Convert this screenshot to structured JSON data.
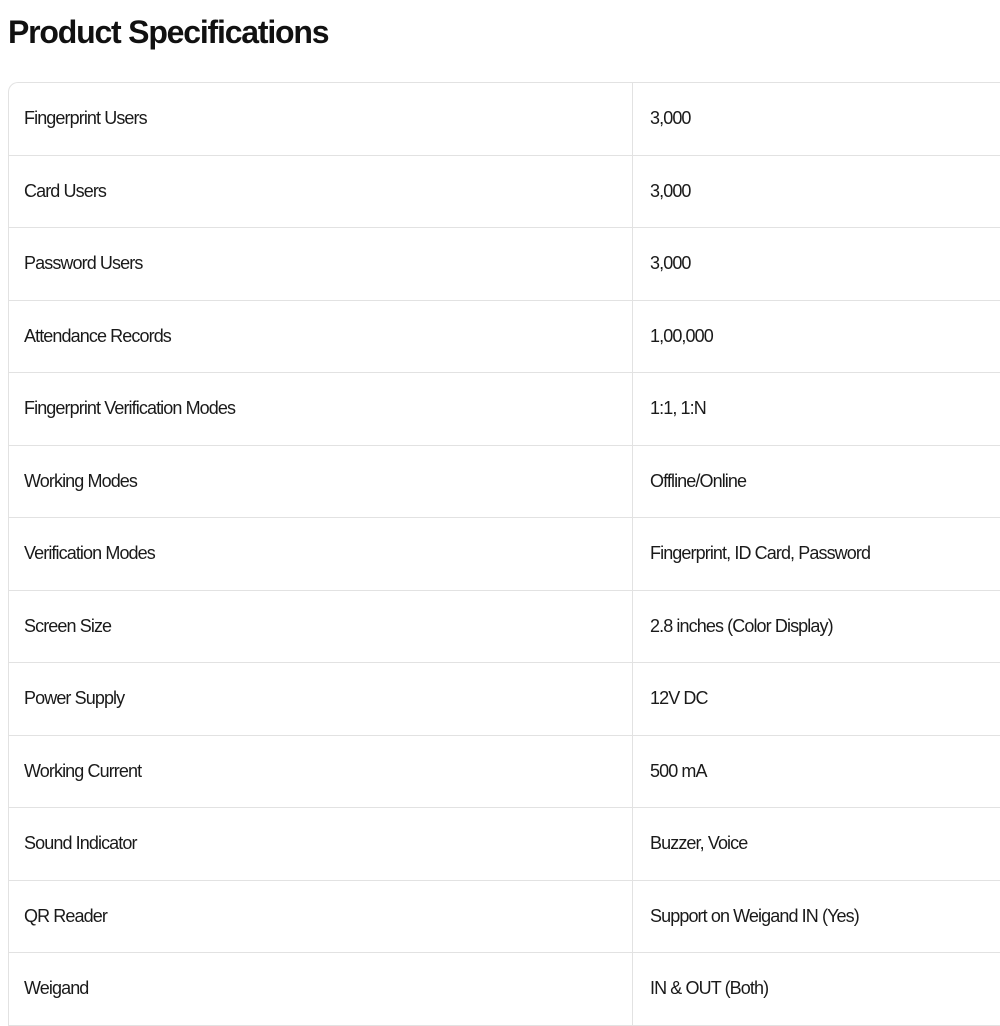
{
  "page": {
    "title": "Product Specifications"
  },
  "specs": [
    {
      "name": "Fingerprint Users",
      "value": "3,000"
    },
    {
      "name": "Card Users",
      "value": "3,000"
    },
    {
      "name": "Password Users",
      "value": "3,000"
    },
    {
      "name": "Attendance Records",
      "value": "1,00,000"
    },
    {
      "name": "Fingerprint Verification Modes",
      "value": "1:1, 1:N"
    },
    {
      "name": "Working Modes",
      "value": "Offline/Online"
    },
    {
      "name": "Verification Modes",
      "value": "Fingerprint, ID Card, Password"
    },
    {
      "name": "Screen Size",
      "value": "2.8 inches (Color Display)"
    },
    {
      "name": "Power Supply",
      "value": "12V DC"
    },
    {
      "name": "Working Current",
      "value": "500 mA"
    },
    {
      "name": "Sound Indicator",
      "value": "Buzzer, Voice"
    },
    {
      "name": "QR Reader",
      "value": "Support on Weigand IN (Yes)"
    },
    {
      "name": "Weigand",
      "value": "IN & OUT (Both)"
    }
  ],
  "colors": {
    "border": "#e2e2e2",
    "text": "#1a1a1a",
    "background": "#ffffff"
  }
}
